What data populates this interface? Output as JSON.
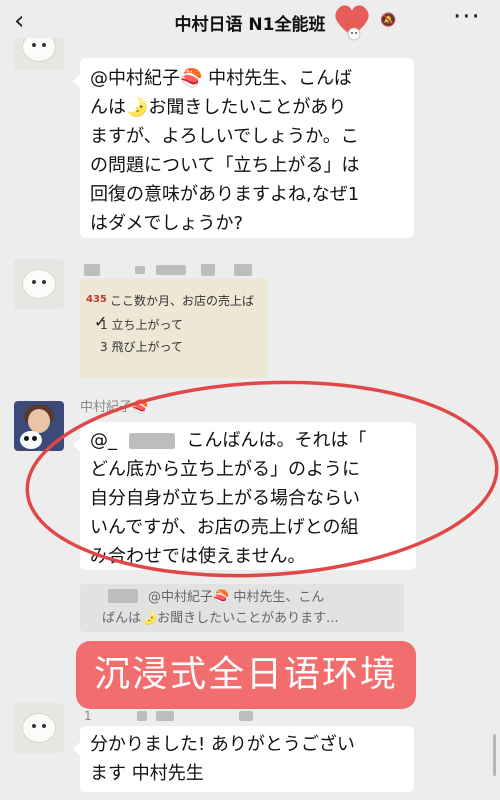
{
  "header": {
    "back_icon": "chevron-left",
    "title": "中村日语 N1全能班",
    "bell_icon": "muted-bell",
    "more_icon": "ellipsis"
  },
  "messages": [
    {
      "lines": [
        "@中村紀子🍣 中村先生、こんば",
        "んは🌛お聞きしたいことがあり",
        "ますが、よろしいでしょうか。こ",
        "の問題について「立ち上がる」は",
        "回復の意味がありますよね,なぜ1",
        "はダメでしょうか?"
      ]
    },
    {
      "photo": {
        "number": "435",
        "line1": "ここ数か月、お店の売上ば",
        "line2": "1  立ち上がって",
        "line3": "3  飛び上がって"
      }
    },
    {
      "sender": "中村紀子🍣",
      "mention": "@_",
      "line1_rest": "こんばんは。それは「",
      "lines": [
        "どん底から立ち上がる」のように",
        "自分自身が立ち上がる場合ならい",
        "いんですが、お店の売上げとの組",
        "み合わせでは使えません。"
      ],
      "quote_line1": "@中村紀子🍣 中村先生、こん",
      "quote_line2": "ばんは🌛お聞きしたいことがあります..."
    },
    {
      "sender_num": "1",
      "lines": [
        "分かりました! ありがとうござい",
        "ます 中村先生"
      ]
    }
  ],
  "banner": "沉浸式全日语环境",
  "colors": {
    "background": "#ededed",
    "bubble": "#ffffff",
    "banner": "#f26d6d",
    "circle": "#e04848"
  }
}
